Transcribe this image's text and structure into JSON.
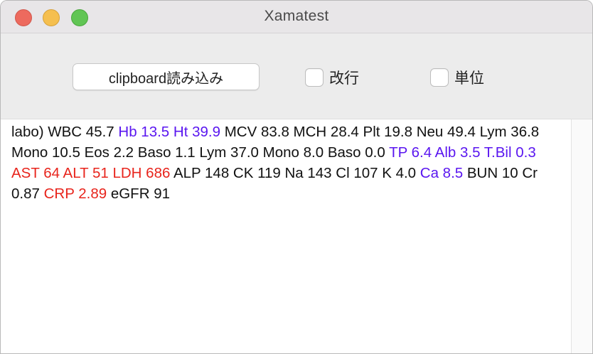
{
  "window": {
    "title": "Xamatest"
  },
  "toolbar": {
    "clipboard_button": "clipboard読み込み",
    "checkbox_newline": {
      "label": "改行",
      "checked": false
    },
    "checkbox_unit": {
      "label": "単位",
      "checked": false
    }
  },
  "colors": {
    "normal": "#111111",
    "low": "#5a16f0",
    "high": "#e8241c"
  },
  "content": {
    "tokens": [
      {
        "text": "labo) WBC 45.7 ",
        "status": "normal"
      },
      {
        "text": "Hb 13.5 Ht 39.9",
        "status": "low"
      },
      {
        "text": " MCV 83.8 MCH 28.4 Plt 19.8 Neu 49.4 Lym 36.8 Mono 10.5 Eos 2.2 Baso 1.1 Lym 37.0 Mono 8.0 Baso 0.0 ",
        "status": "normal"
      },
      {
        "text": "TP 6.4 Alb 3.5 T.Bil 0.3",
        "status": "low"
      },
      {
        "text": " ",
        "status": "normal"
      },
      {
        "text": "AST 64 ALT 51 LDH 686",
        "status": "high"
      },
      {
        "text": " ALP 148 CK 119 Na 143 Cl 107 K 4.0 ",
        "status": "normal"
      },
      {
        "text": "Ca 8.5",
        "status": "low"
      },
      {
        "text": " BUN 10 Cr 0.87 ",
        "status": "normal"
      },
      {
        "text": "CRP 2.89",
        "status": "high"
      },
      {
        "text": " eGFR 91",
        "status": "normal"
      }
    ]
  }
}
